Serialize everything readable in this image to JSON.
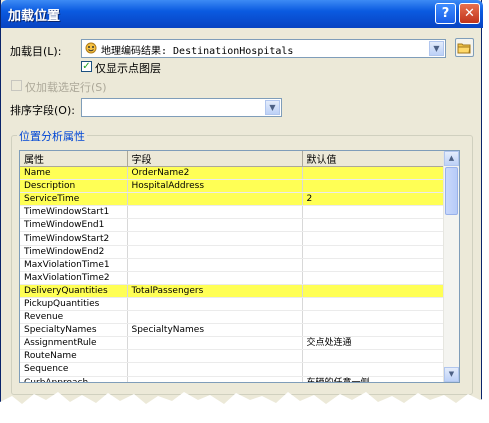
{
  "window": {
    "title": "加载位置",
    "help_label": "?",
    "close_label": "✕"
  },
  "load_to": {
    "label": "加载目(L):",
    "value": "地理编码结果: DestinationHospitals",
    "icon": "geocode-layer-icon"
  },
  "only_display_points": {
    "label": "仅显示点图层",
    "checked": true
  },
  "only_selected": {
    "label": "仅加载选定行(S)",
    "checked": false,
    "enabled": false
  },
  "sort_field": {
    "label": "排序字段(O):",
    "value": ""
  },
  "group": {
    "title": "位置分析属性"
  },
  "grid": {
    "headers": [
      "属性",
      "字段",
      "默认值"
    ],
    "rows": [
      {
        "property": "Name",
        "field": "OrderName2",
        "default": "",
        "highlight": true
      },
      {
        "property": "Description",
        "field": "HospitalAddress",
        "default": "",
        "highlight": true
      },
      {
        "property": "ServiceTime",
        "field": "",
        "default": "2",
        "highlight": true
      },
      {
        "property": "TimeWindowStart1",
        "field": "",
        "default": "",
        "highlight": false
      },
      {
        "property": "TimeWindowEnd1",
        "field": "",
        "default": "",
        "highlight": false
      },
      {
        "property": "TimeWindowStart2",
        "field": "",
        "default": "",
        "highlight": false
      },
      {
        "property": "TimeWindowEnd2",
        "field": "",
        "default": "",
        "highlight": false
      },
      {
        "property": "MaxViolationTime1",
        "field": "",
        "default": "",
        "highlight": false
      },
      {
        "property": "MaxViolationTime2",
        "field": "",
        "default": "",
        "highlight": false
      },
      {
        "property": "DeliveryQuantities",
        "field": "TotalPassengers",
        "default": "",
        "highlight": true
      },
      {
        "property": "PickupQuantities",
        "field": "",
        "default": "",
        "highlight": false
      },
      {
        "property": "Revenue",
        "field": "",
        "default": "",
        "highlight": false
      },
      {
        "property": "SpecialtyNames",
        "field": "SpecialtyNames",
        "default": "",
        "highlight": false
      },
      {
        "property": "AssignmentRule",
        "field": "",
        "default": "交点处连通",
        "highlight": false
      },
      {
        "property": "RouteName",
        "field": "",
        "default": "",
        "highlight": false
      },
      {
        "property": "Sequence",
        "field": "",
        "default": "",
        "highlight": false
      },
      {
        "property": "CurbApproach",
        "field": "",
        "default": "车辆的任意一侧",
        "highlight": false
      }
    ]
  },
  "colors": {
    "highlight": "#ffff55",
    "titlebar": "#0a5ae0",
    "group_title": "#0046d5"
  }
}
